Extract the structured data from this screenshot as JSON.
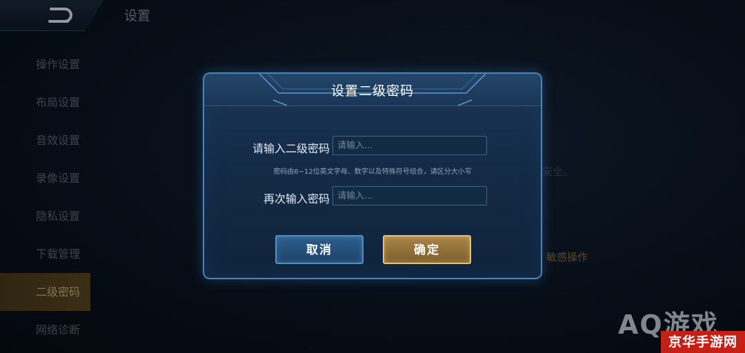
{
  "header": {
    "title": "设置"
  },
  "sidebar": {
    "items": [
      {
        "label": "操作设置"
      },
      {
        "label": "布局设置"
      },
      {
        "label": "音效设置"
      },
      {
        "label": "录像设置"
      },
      {
        "label": "隐私设置"
      },
      {
        "label": "下载管理"
      },
      {
        "label": "二级密码",
        "active": true
      },
      {
        "label": "网络诊断"
      }
    ]
  },
  "background": {
    "text_partial": "安全。",
    "link_text": "敏感操作",
    "logo_text": "AQ游戏"
  },
  "dialog": {
    "title": "设置二级密码",
    "password_label": "请输入二级密码",
    "password_placeholder": "请输入...",
    "hint": "密码由6~12位英文字母、数字以及特殊符号组合，请区分大小写",
    "confirm_label": "再次输入密码",
    "confirm_placeholder": "请输入...",
    "cancel_button": "取消",
    "ok_button": "确定"
  },
  "watermark": {
    "text": "京华手游网"
  },
  "colors": {
    "dialog_border": "#4a86b8",
    "confirm_gold": "#e4c27c",
    "active_tab": "#5b4722",
    "watermark_red": "#c62016"
  }
}
